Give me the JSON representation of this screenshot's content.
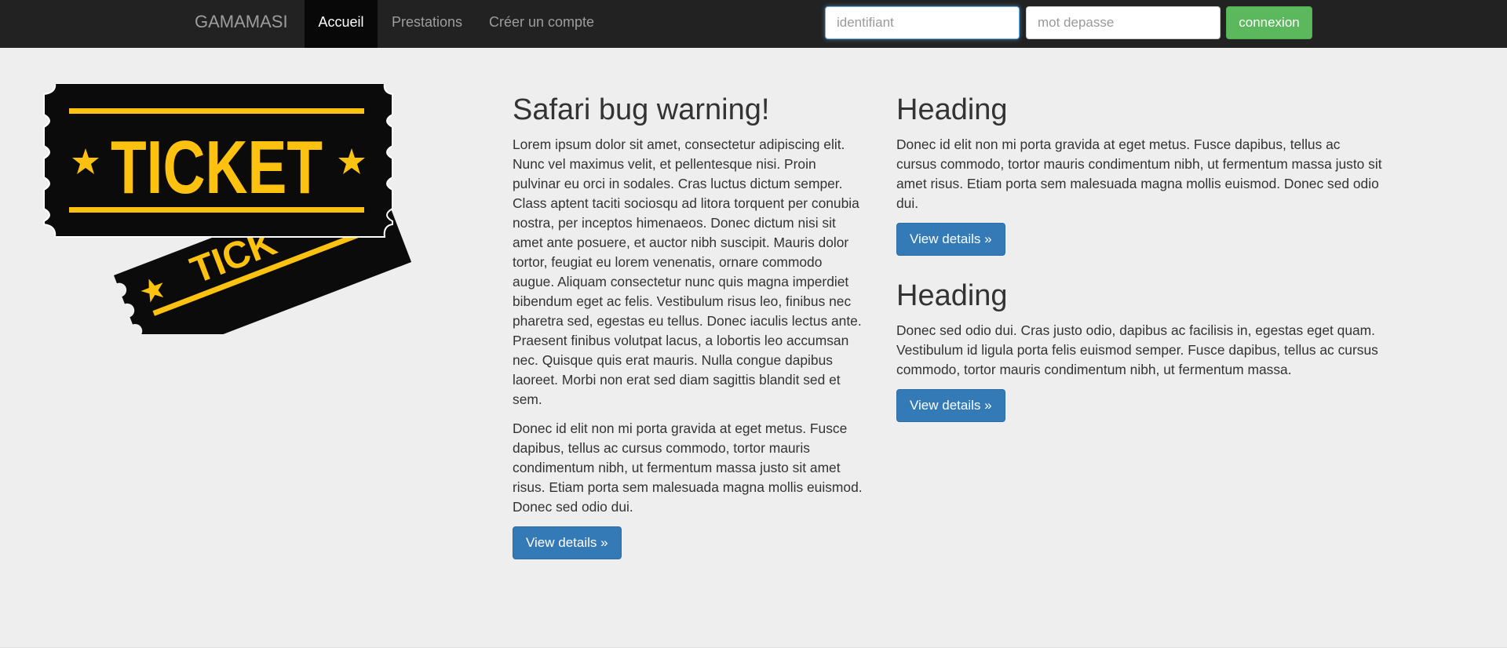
{
  "navbar": {
    "brand": "GAMAMASI",
    "items": [
      {
        "label": "Accueil",
        "active": true
      },
      {
        "label": "Prestations",
        "active": false
      },
      {
        "label": "Créer un compte",
        "active": false
      }
    ],
    "login": {
      "id_placeholder": "identifiant",
      "password_placeholder": "mot depasse",
      "submit_label": "connexion"
    }
  },
  "hero_image": {
    "text": "TICKET",
    "colors": {
      "body": "#0b0b0b",
      "accent": "#fcc20f"
    }
  },
  "main": {
    "left": {
      "title": "Safari bug warning!",
      "paragraph1": "Lorem ipsum dolor sit amet, consectetur adipiscing elit. Nunc vel maximus velit, et pellentesque nisi. Proin pulvinar eu orci in sodales. Cras luctus dictum semper. Class aptent taciti sociosqu ad litora torquent per conubia nostra, per inceptos himenaeos. Donec dictum nisi sit amet ante posuere, et auctor nibh suscipit. Mauris dolor tortor, feugiat eu lorem venenatis, ornare commodo augue. Aliquam consectetur nunc quis magna imperdiet bibendum eget ac felis. Vestibulum risus leo, finibus nec pharetra sed, egestas eu tellus. Donec iaculis lectus ante. Praesent finibus volutpat lacus, a lobortis leo accumsan nec. Quisque quis erat mauris. Nulla congue dapibus laoreet. Morbi non erat sed diam sagittis blandit sed et sem.",
      "paragraph2": "Donec id elit non mi porta gravida at eget metus. Fusce dapibus, tellus ac cursus commodo, tortor mauris condimentum nibh, ut fermentum massa justo sit amet risus. Etiam porta sem malesuada magna mollis euismod. Donec sed odio dui.",
      "button": "View details »"
    },
    "right": [
      {
        "title": "Heading",
        "text": "Donec id elit non mi porta gravida at eget metus. Fusce dapibus, tellus ac cursus commodo, tortor mauris condimentum nibh, ut fermentum massa justo sit amet risus. Etiam porta sem malesuada magna mollis euismod. Donec sed odio dui.",
        "button": "View details »"
      },
      {
        "title": "Heading",
        "text": "Donec sed odio dui. Cras justo odio, dapibus ac facilisis in, egestas eget quam. Vestibulum id ligula porta felis euismod semper. Fusce dapibus, tellus ac cursus commodo, tortor mauris condimentum nibh, ut fermentum massa.",
        "button": "View details »"
      }
    ]
  },
  "colors": {
    "navbar_bg": "#222222",
    "active_nav_bg": "#080808",
    "main_bg": "#eeeeee",
    "primary": "#337ab7",
    "success": "#5cb85c"
  }
}
